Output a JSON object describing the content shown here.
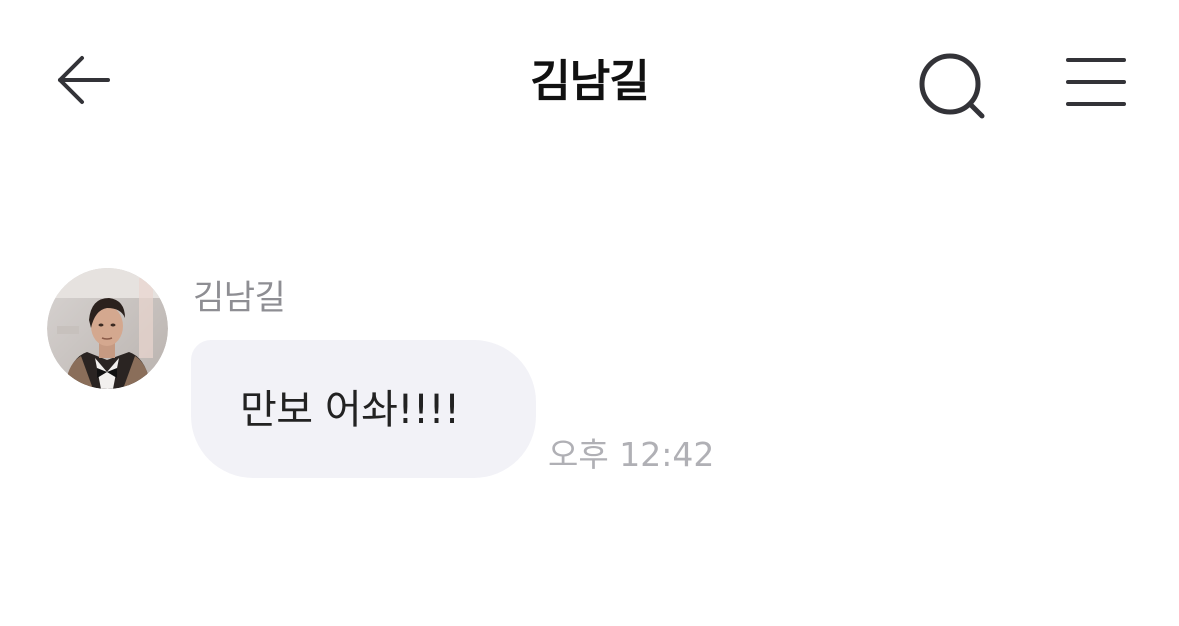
{
  "header": {
    "back_icon": "arrow-left-icon",
    "title": "김남길",
    "search_icon": "search-icon",
    "menu_icon": "hamburger-menu-icon"
  },
  "colors": {
    "icon": "#333338",
    "title": "#111111",
    "sender_name": "#8e8e93",
    "bubble_bg": "#f2f2f7",
    "bubble_text": "#222222",
    "timestamp": "#b0b0b5"
  },
  "messages": [
    {
      "sender": "김남길",
      "avatar": "profile-photo",
      "text": "만보 어솨!!!!",
      "time": "오후 12:42"
    }
  ]
}
